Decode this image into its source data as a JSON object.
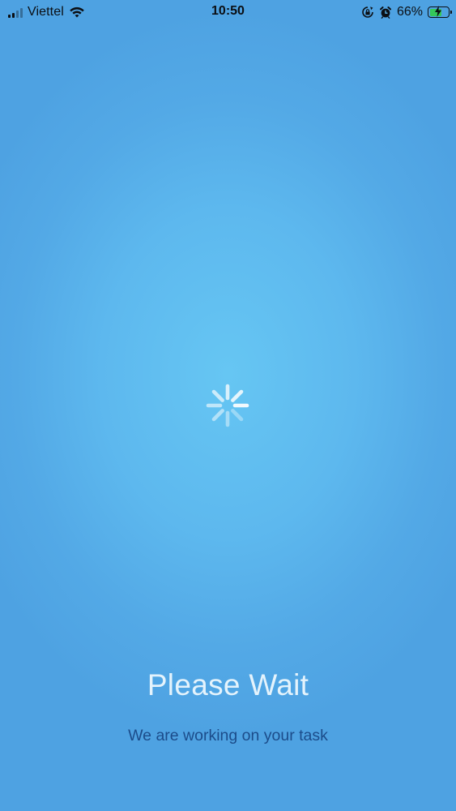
{
  "status_bar": {
    "carrier": "Viettel",
    "time": "10:50",
    "battery_percent": "66%",
    "battery_level": 0.66,
    "signal_bars": 4,
    "signal_active": 2,
    "icons": [
      "signal-icon",
      "wifi-icon",
      "orientation-lock-icon",
      "alarm-icon",
      "battery-icon",
      "charging-bolt-icon"
    ]
  },
  "loading": {
    "spinner_icon": "activity-spinner-icon",
    "title": "Please Wait",
    "subtitle": "We are working on your task"
  },
  "colors": {
    "background_center": "#66c6f3",
    "background_edge": "#4ea2e2",
    "title_text": "#e4f3fc",
    "subtitle_text": "#1c4c8a",
    "battery_fill": "#34c759"
  }
}
